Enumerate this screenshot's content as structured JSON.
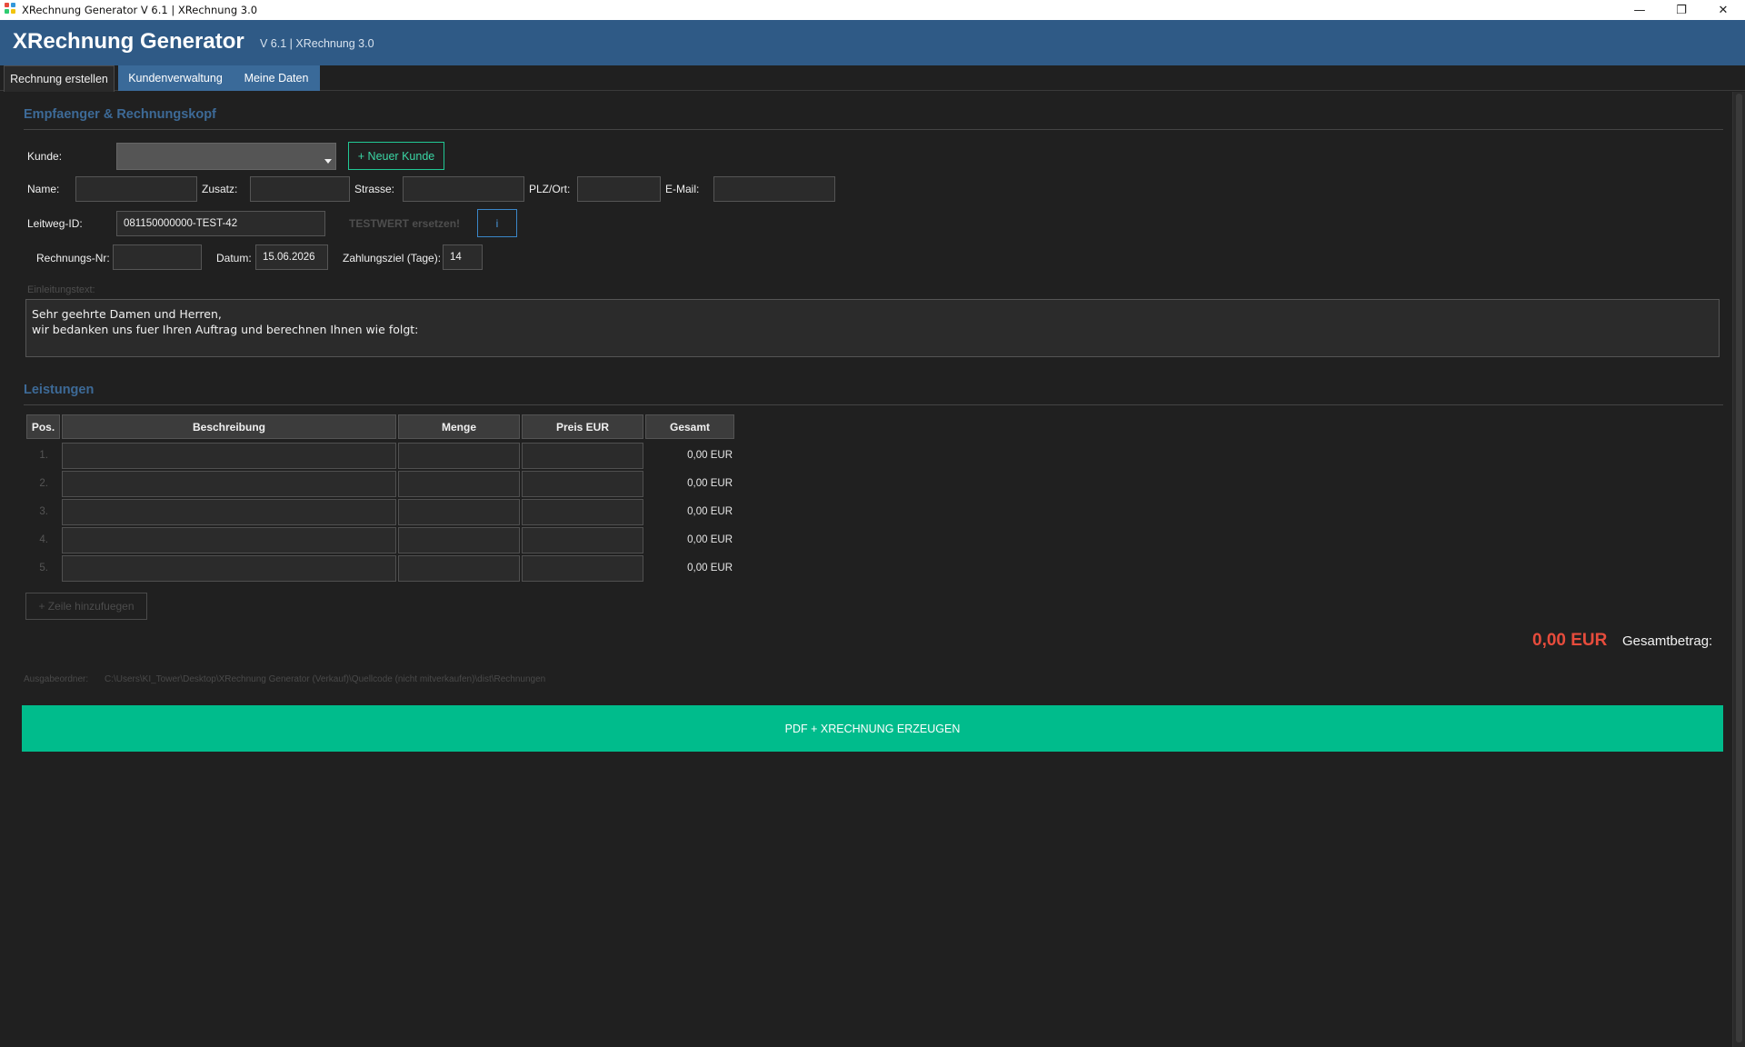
{
  "window": {
    "title": "XRechnung Generator  V 6.1  |  XRechnung 3.0",
    "minimize": "—",
    "restore": "❐",
    "close": "✕"
  },
  "header": {
    "app_title": "XRechnung Generator",
    "version": "V 6.1  |  XRechnung 3.0"
  },
  "tabs": [
    {
      "label": "Rechnung erstellen",
      "active": true
    },
    {
      "label": "Kundenverwaltung",
      "active": false
    },
    {
      "label": "Meine Daten",
      "active": false
    }
  ],
  "recipient": {
    "section_title": "Empfaenger & Rechnungskopf",
    "kunde_label": "Kunde:",
    "kunde_value": "",
    "new_customer_button": "+ Neuer Kunde",
    "name_label": "Name:",
    "name_value": "",
    "zusatz_label": "Zusatz:",
    "zusatz_value": "",
    "strasse_label": "Strasse:",
    "strasse_value": "",
    "plz_label": "PLZ/Ort:",
    "plz_value": "",
    "email_label": "E-Mail:",
    "email_value": "",
    "leitweg_label": "Leitweg-ID:",
    "leitweg_value": "081150000000-TEST-42",
    "testwert_hint": "TESTWERT ersetzen!",
    "info_button": "i",
    "rechnungsnr_label": "Rechnungs-Nr:",
    "rechnungsnr_value": "",
    "datum_label": "Datum:",
    "datum_value": "15.06.2026",
    "zahlungsziel_label": "Zahlungsziel (Tage):",
    "zahlungsziel_value": "14",
    "intro_label": "Einleitungstext:",
    "intro_line1": "Sehr geehrte Damen und Herren,",
    "intro_line2": "wir bedanken uns fuer Ihren Auftrag und berechnen Ihnen wie folgt:"
  },
  "services": {
    "section_title": "Leistungen",
    "columns": [
      "Pos.",
      "Beschreibung",
      "Menge",
      "Preis EUR",
      "Gesamt"
    ],
    "rows": [
      {
        "pos": "1.",
        "beschreibung": "",
        "menge": "",
        "preis": "",
        "gesamt": "0,00 EUR"
      },
      {
        "pos": "2.",
        "beschreibung": "",
        "menge": "",
        "preis": "",
        "gesamt": "0,00 EUR"
      },
      {
        "pos": "3.",
        "beschreibung": "",
        "menge": "",
        "preis": "",
        "gesamt": "0,00 EUR"
      },
      {
        "pos": "4.",
        "beschreibung": "",
        "menge": "",
        "preis": "",
        "gesamt": "0,00 EUR"
      },
      {
        "pos": "5.",
        "beschreibung": "",
        "menge": "",
        "preis": "",
        "gesamt": "0,00 EUR"
      }
    ],
    "add_row_button": "+  Zeile hinzufuegen",
    "total_amount": "0,00 EUR",
    "total_label": "Gesamtbetrag:"
  },
  "output": {
    "folder_label": "Ausgabeordner:",
    "folder_path": "C:\\Users\\KI_Tower\\Desktop\\XRechnung Generator (Verkauf)\\Quellcode (nicht mitverkaufen)\\dist\\Rechnungen",
    "generate_button": "PDF + XRECHNUNG ERZEUGEN"
  },
  "colors": {
    "header_bg": "#2f5a86",
    "accent_green": "#00bc8c",
    "total_red": "#e74c3c",
    "section_blue": "#3d6a97",
    "info_blue": "#3a86c8"
  }
}
